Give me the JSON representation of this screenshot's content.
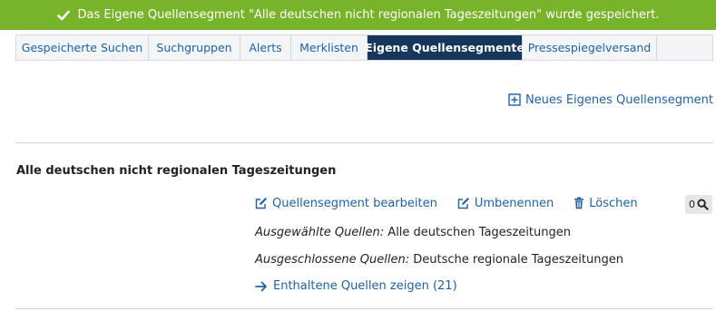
{
  "banner": {
    "message": "Das Eigene Quellensegment \"Alle deutschen nicht regionalen Tageszeitungen\" wurde gespeichert.",
    "icon": "check-icon",
    "color": "#78b42a"
  },
  "tabs": [
    {
      "label": "Gespeicherte Suchen",
      "active": false
    },
    {
      "label": "Suchgruppen",
      "active": false
    },
    {
      "label": "Alerts",
      "active": false
    },
    {
      "label": "Merklisten",
      "active": false
    },
    {
      "label": "Eigene Quellensegmente",
      "active": true
    },
    {
      "label": "Pressespiegelversand",
      "active": false
    }
  ],
  "new_segment": {
    "label": "Neues Eigenes Quellensegment",
    "icon": "plus-square-icon"
  },
  "segment": {
    "title": "Alle deutschen nicht regionalen Tageszeitungen",
    "actions": {
      "edit": "Quellensegment bearbeiten",
      "rename": "Umbenennen",
      "delete": "Löschen"
    },
    "count": "0",
    "selected_label": "Ausgewählte Quellen:",
    "selected_value": "Alle deutschen Tageszeitungen",
    "excluded_label": "Ausgeschlossene Quellen:",
    "excluded_value": "Deutsche regionale Tageszeitungen",
    "show_sources": "Enthaltene Quellen zeigen (21)"
  },
  "colors": {
    "link": "#1b62ab",
    "active_tab": "#16365c"
  }
}
